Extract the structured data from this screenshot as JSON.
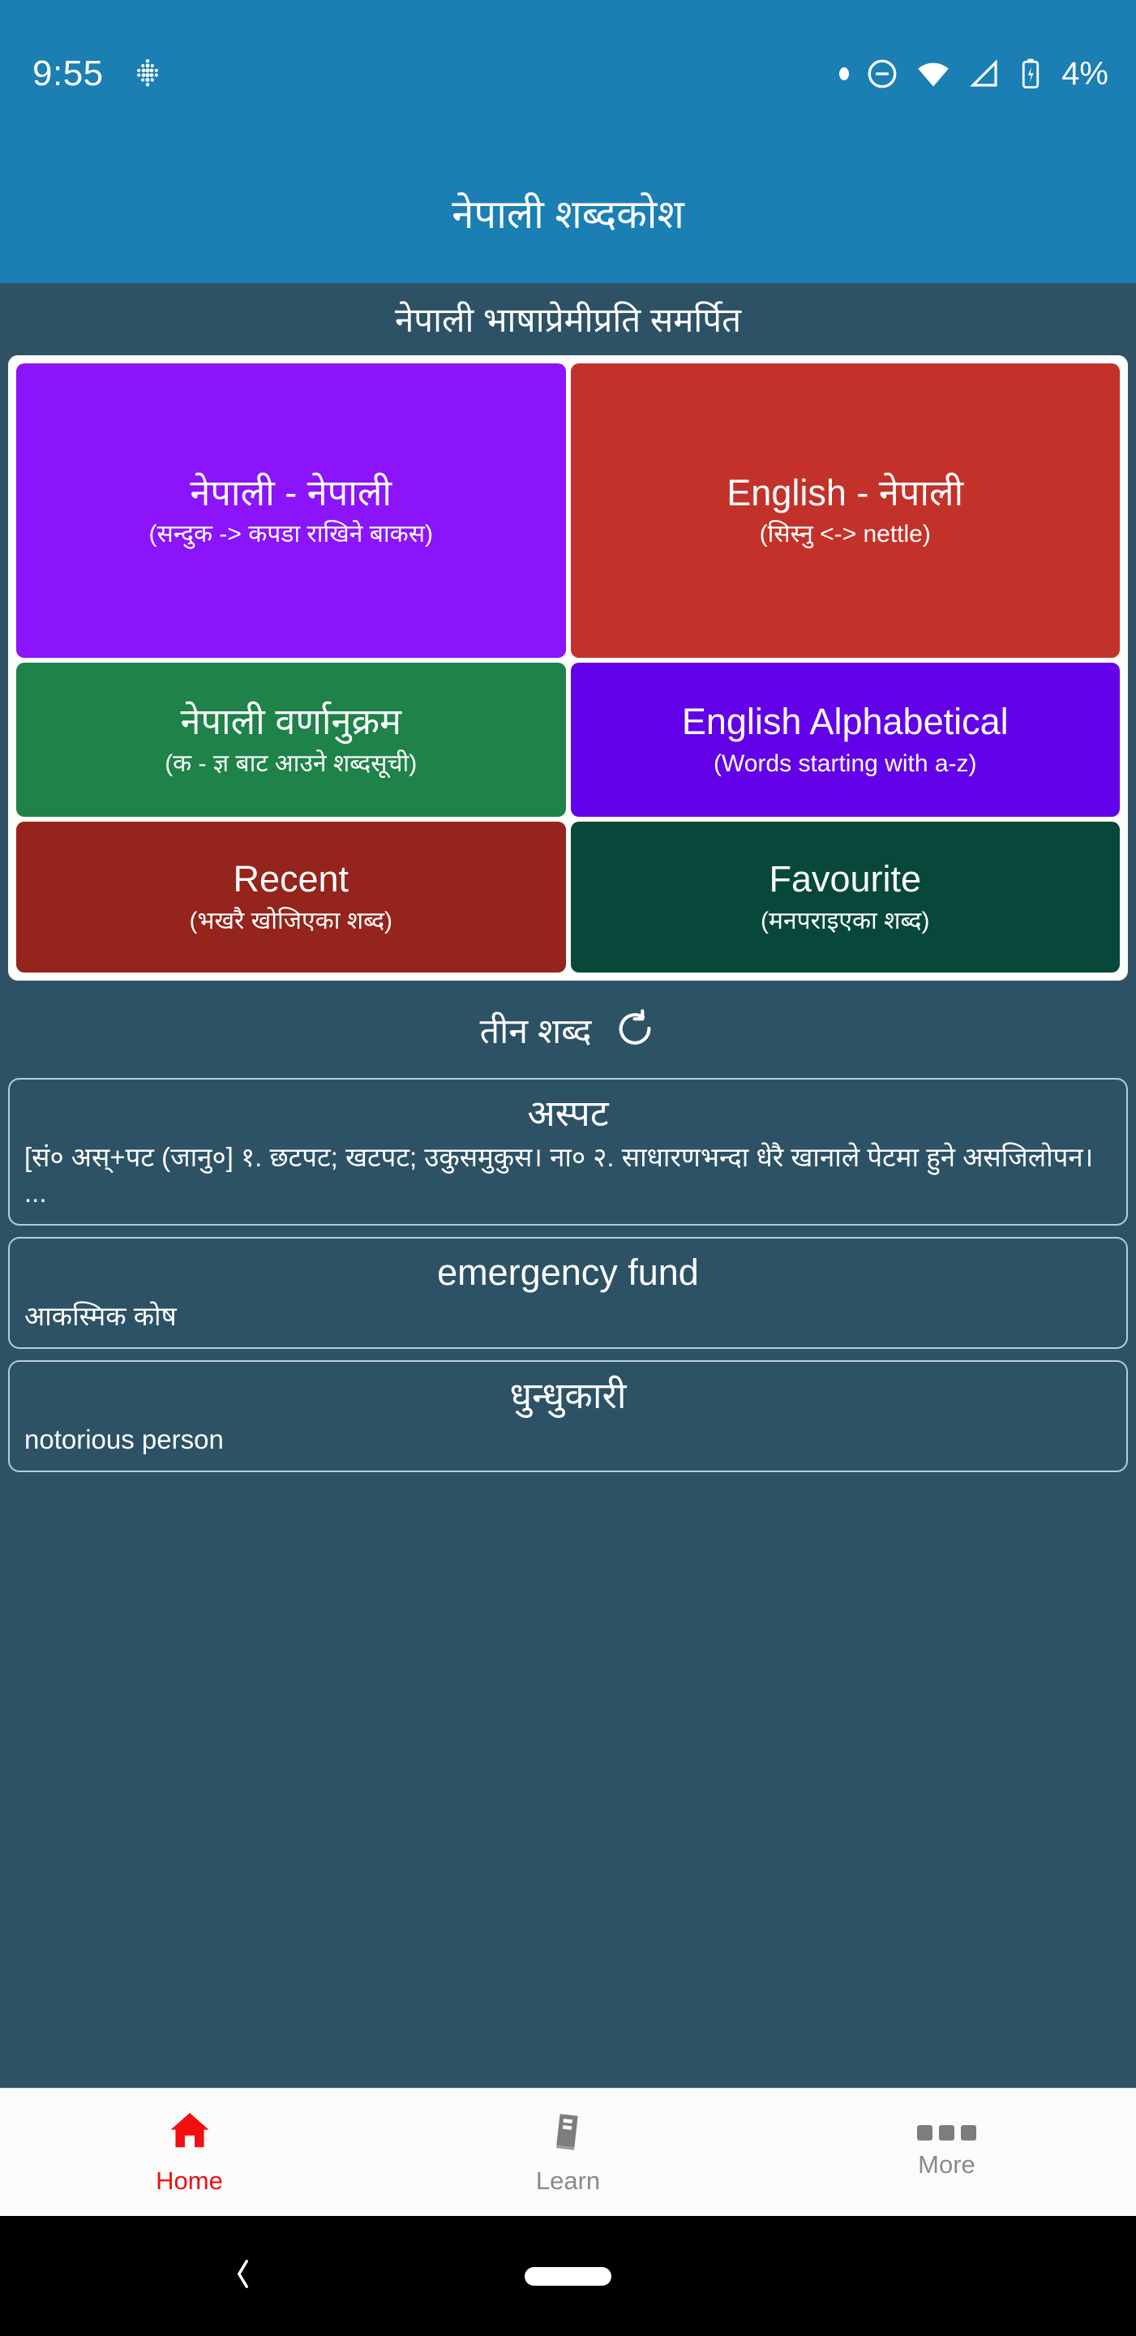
{
  "status_bar": {
    "time": "9:55",
    "battery_percent": "4%",
    "icons": [
      "app-dots-icon",
      "notification-dot-icon",
      "do-not-disturb-icon",
      "wifi-icon",
      "cellular-signal-icon",
      "battery-icon"
    ]
  },
  "app_bar": {
    "title": "नेपाली शब्दकोश"
  },
  "subtitle": "नेपाली भाषाप्रेमीप्रति समर्पित",
  "colors": {
    "primary": "#1b7fb4",
    "background": "#2d5265",
    "tile_purple": "#8b14fb",
    "tile_red": "#c3322a",
    "tile_green": "#1e8249",
    "tile_violet": "#6302e8",
    "tile_dark_red": "#94241c",
    "tile_dark_teal": "#08483b",
    "nav_active": "#f10f0f",
    "nav_inactive": "#8a8a8a"
  },
  "tiles": [
    {
      "title": "नेपाली - नेपाली",
      "subtitle": "(सन्दुक -> कपडा राखिने बाकस)",
      "color": "#8b14fb"
    },
    {
      "title": "English - नेपाली",
      "subtitle": "(सिस्नु <-> nettle)",
      "color": "#c3322a"
    },
    {
      "title": "नेपाली वर्णानुक्रम",
      "subtitle": "(क - ज्ञ बाट आउने शब्दसूची)",
      "color": "#1e8249"
    },
    {
      "title": "English Alphabetical",
      "subtitle": "(Words starting with a-z)",
      "color": "#6302e8"
    },
    {
      "title": "Recent",
      "subtitle": "(भखरै खोजिएका शब्द)",
      "color": "#94241c"
    },
    {
      "title": "Favourite",
      "subtitle": "(मनपराइएका शब्द)",
      "color": "#08483b"
    }
  ],
  "words_section": {
    "heading": "तीन शब्द",
    "refresh_icon": "refresh-icon",
    "words": [
      {
        "word": "अस्पट",
        "definition": "[सं० अस्+पट (जानु०] १. छटपट; खटपट; उकुसमुकुस। ना० २. साधारणभन्दा धेरै खानाले पेटमा हुने असजिलोपन। ..."
      },
      {
        "word": "emergency fund",
        "definition": "आकस्मिक कोष"
      },
      {
        "word": "धुन्धुकारी",
        "definition": "notorious person"
      }
    ]
  },
  "bottom_nav": [
    {
      "label": "Home",
      "icon": "home-icon",
      "active": true
    },
    {
      "label": "Learn",
      "icon": "book-icon",
      "active": false
    },
    {
      "label": "More",
      "icon": "more-dots-icon",
      "active": false
    }
  ],
  "android_nav": {
    "back": "back-chevron-icon",
    "home": "home-pill-icon"
  }
}
